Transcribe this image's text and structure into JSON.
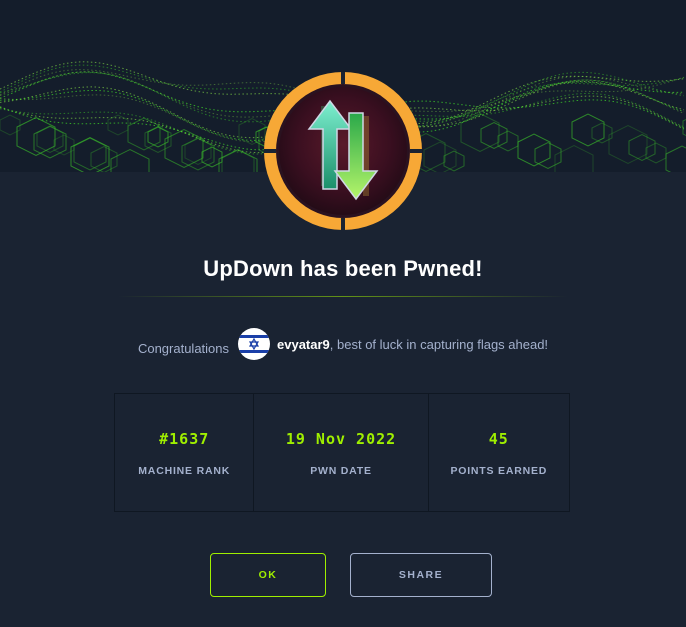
{
  "title": "UpDown has been Pwned!",
  "congrats": {
    "lead": "Congratulations",
    "username": "evyatar9",
    "suffix": ", best of luck in capturing flags ahead!",
    "avatar_flag": "israel-flag-icon"
  },
  "stats": [
    {
      "value": "#1637",
      "label": "MACHINE RANK"
    },
    {
      "value": "19 Nov 2022",
      "label": "PWN DATE"
    },
    {
      "value": "45",
      "label": "POINTS EARNED"
    }
  ],
  "buttons": {
    "ok": "OK",
    "share": "SHARE"
  },
  "colors": {
    "background": "#1a2332",
    "accent": "#9fef00",
    "badge_ring": "#f7a836",
    "muted_text": "#a4b1cd"
  },
  "badge_icon": "up-down-arrows-icon"
}
